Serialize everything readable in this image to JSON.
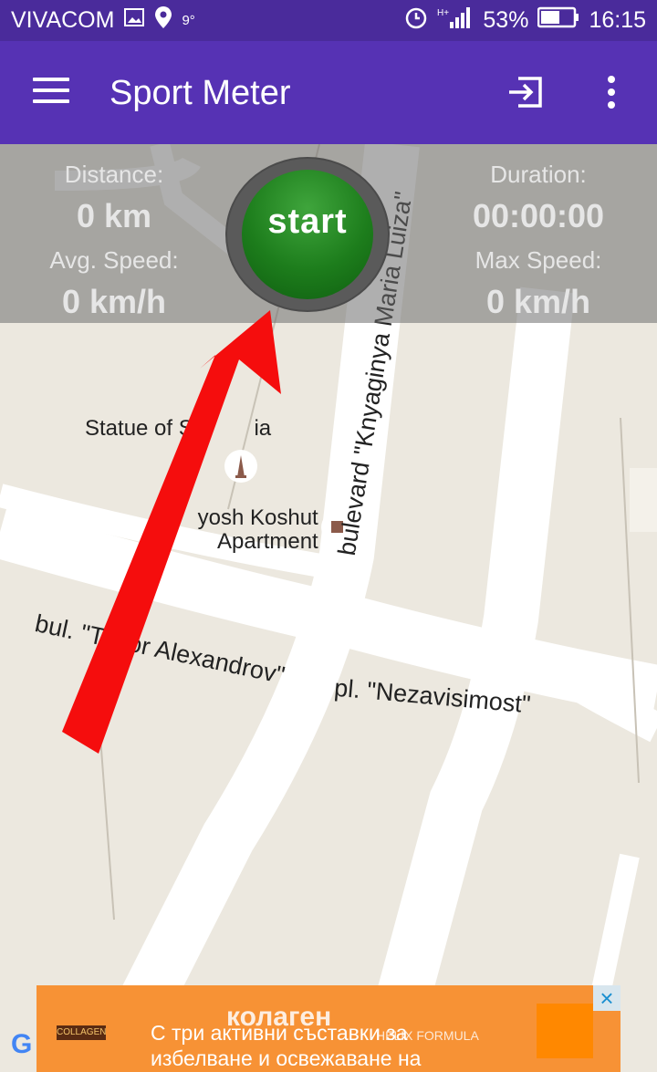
{
  "statusbar": {
    "carrier": "VIVACOM",
    "temp": "9°",
    "battery": "53%",
    "time": "16:15"
  },
  "appbar": {
    "title": "Sport Meter"
  },
  "stats": {
    "distance_label": "Distance:",
    "distance_value": "0 km",
    "duration_label": "Duration:",
    "duration_value": "00:00:00",
    "avg_label": "Avg. Speed:",
    "avg_value": "0 km/h",
    "max_label": "Max Speed:",
    "max_value": "0 km/h"
  },
  "start_button": {
    "label": "start"
  },
  "map": {
    "poi1": "Statue of Sai",
    "poi1b": "ia",
    "poi2a": "yosh Koshut",
    "poi2b": "Apartment",
    "street1": "bulevard \"Knyaginya Maria Luiza\"",
    "street2": "bul. \"T",
    "street2b": "or Alexandrov\"",
    "street3": "pl. \"Nezavisimost\""
  },
  "ad": {
    "title": "колаген",
    "text_line1": "С три активни съставки за",
    "text_line2": "избелване и освежаване на",
    "brand": "HELIX FORMULA",
    "logo_text": "COLLAGEN",
    "close": "×"
  },
  "google": "G"
}
